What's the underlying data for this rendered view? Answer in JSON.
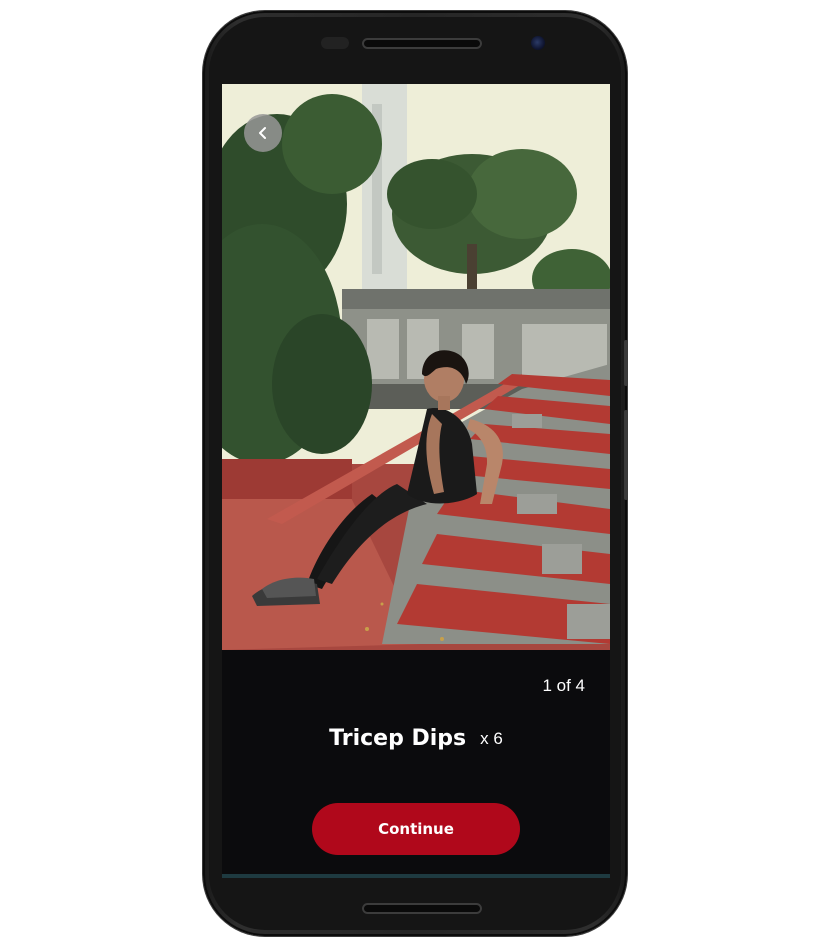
{
  "exercise": {
    "name": "Tricep Dips",
    "reps": "x 6"
  },
  "progress": {
    "text": "1 of 4",
    "current": 1,
    "total": 4
  },
  "actions": {
    "continue_label": "Continue"
  },
  "icons": {
    "back": "chevron-left-icon"
  },
  "colors": {
    "accent": "#b0081b",
    "screen_background": "#0b0b0d",
    "text": "#ffffff"
  }
}
